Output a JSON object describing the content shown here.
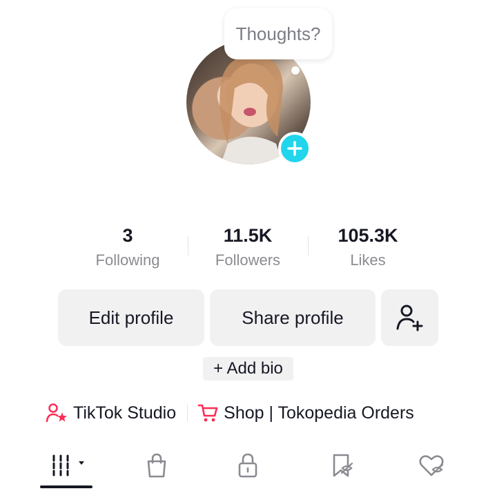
{
  "bubble": {
    "text": "Thoughts?"
  },
  "stats": [
    {
      "value": "3",
      "label": "Following"
    },
    {
      "value": "11.5K",
      "label": "Followers"
    },
    {
      "value": "105.3K",
      "label": "Likes"
    }
  ],
  "buttons": {
    "edit": "Edit profile",
    "share": "Share profile"
  },
  "bio": {
    "add_label": "+ Add bio"
  },
  "links": {
    "studio": "TikTok Studio",
    "shop": "Shop | Tokopedia Orders"
  },
  "tabs": {
    "items": [
      "videos-grid",
      "shop-bag",
      "private-lock",
      "reposts",
      "liked"
    ],
    "active": "videos-grid"
  },
  "colors": {
    "accent_cyan": "#20d5ec",
    "brand_pink": "#fe2c55",
    "text": "#161823",
    "muted": "#8a8b91",
    "button_bg": "#f1f1f2"
  }
}
